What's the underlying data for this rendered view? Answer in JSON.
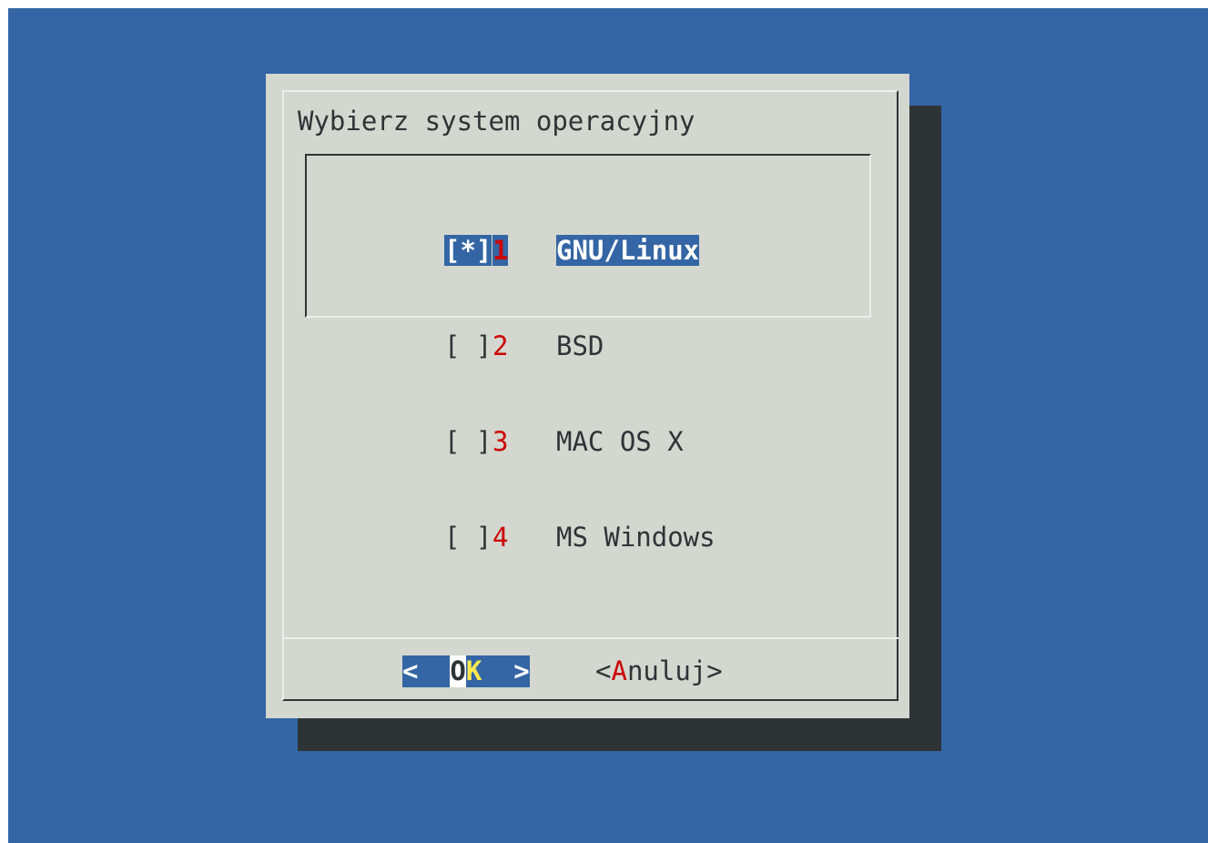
{
  "dialog": {
    "prompt": "Wybierz system operacyjny",
    "items": [
      {
        "mark": "[*]",
        "tag": "1",
        "label": "GNU/Linux",
        "selected": true
      },
      {
        "mark": "[ ]",
        "tag": "2",
        "label": "BSD",
        "selected": false
      },
      {
        "mark": "[ ]",
        "tag": "3",
        "label": "MAC OS X",
        "selected": false
      },
      {
        "mark": "[ ]",
        "tag": "4",
        "label": "MS Windows",
        "selected": false
      }
    ],
    "buttons": {
      "ok": {
        "open": "<",
        "first": "O",
        "hotkey": "K",
        "close": ">"
      },
      "cancel": {
        "open": "<",
        "hotkey": "A",
        "rest": "nuluj",
        "close": ">"
      }
    }
  },
  "colors": {
    "background": "#3465a4",
    "dialog": "#d3d7cf",
    "shadow": "#2e3436",
    "tag": "#cc0000",
    "highlight": "#3465a4",
    "hotkey_ok": "#fce94f"
  }
}
